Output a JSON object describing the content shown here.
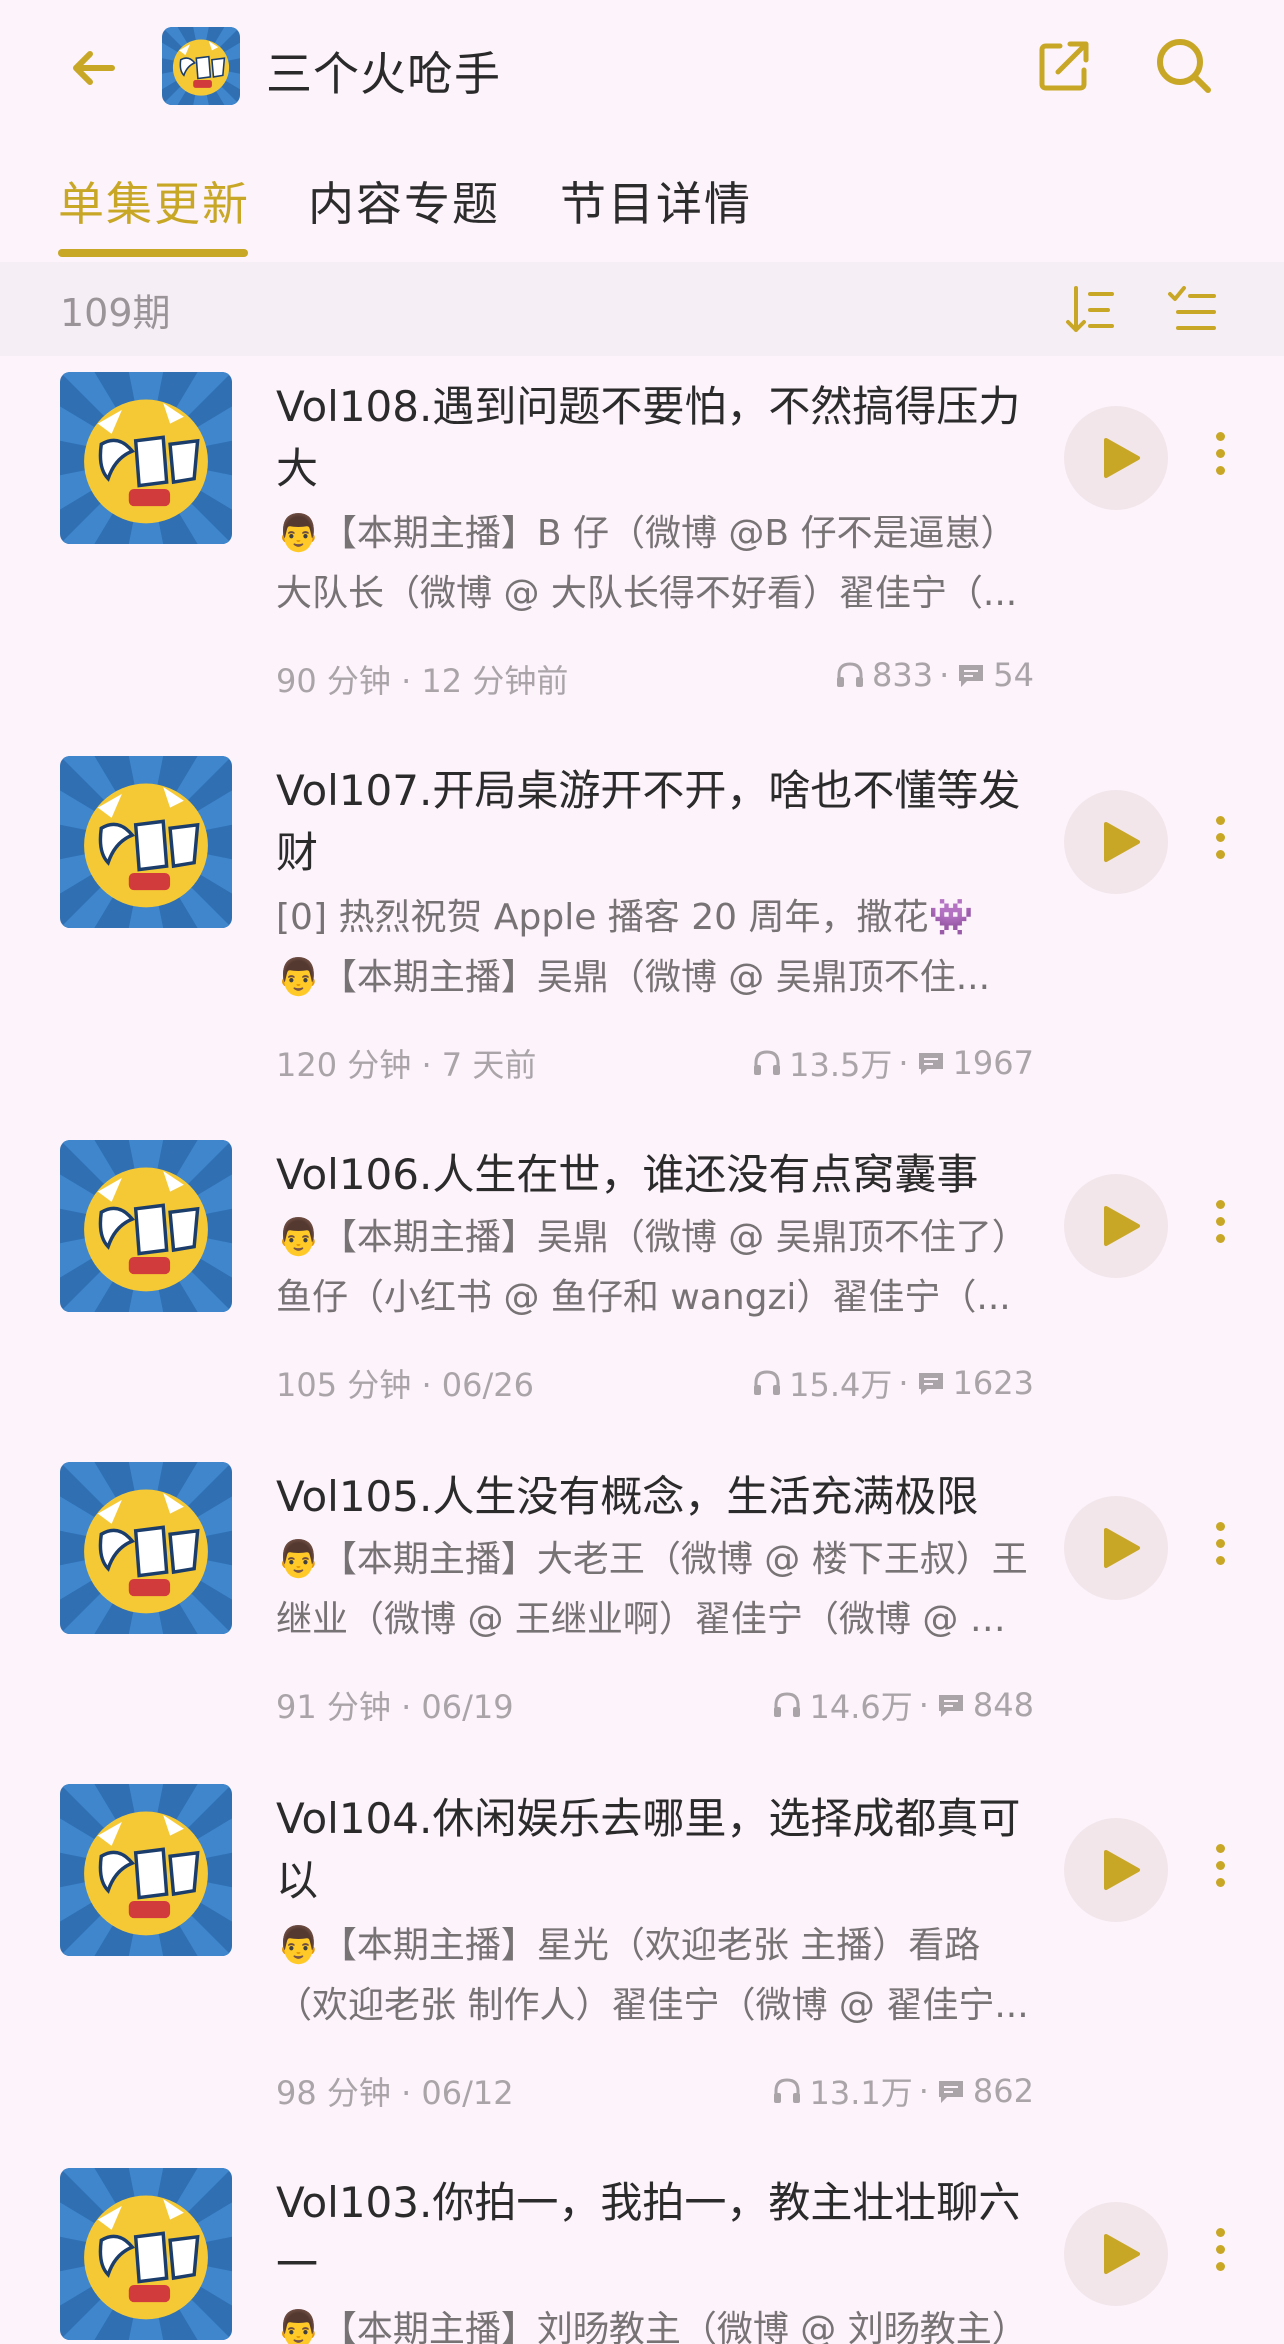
{
  "header": {
    "title": "三个火呛手"
  },
  "tabs": [
    {
      "label": "单集更新",
      "active": true
    },
    {
      "label": "内容专题",
      "active": false
    },
    {
      "label": "节目详情",
      "active": false
    }
  ],
  "subbar": {
    "count": "109期"
  },
  "colors": {
    "accent": "#c9a726",
    "background": "#fcf3fb",
    "muted": "#aaa4a8"
  },
  "icons": {
    "back": "arrow-left-icon",
    "share": "share-icon",
    "search": "search-icon",
    "sort": "sort-icon",
    "filter": "filter-icon",
    "play": "play-icon",
    "more": "more-vertical-icon",
    "listen": "headphones-icon",
    "comment": "comment-icon"
  },
  "episodes": [
    {
      "title": "Vol108.遇到问题不要怕，不然搞得压力大",
      "desc": [
        "👨【本期主播】B 仔（微博 @B 仔不是逼崽）",
        "大队长（微博 @ 大队长得不好看）翟佳宁（..."
      ],
      "duration": "90 分钟",
      "date": "12 分钟前",
      "plays": "833",
      "comments": "54"
    },
    {
      "title": "Vol107.开局桌游开不开，啥也不懂等发财",
      "desc": [
        "[0] 热烈祝贺 Apple 播客 20 周年，撒花👾",
        "👨【本期主播】吴鼎（微博 @ 吴鼎顶不住..."
      ],
      "duration": "120 分钟",
      "date": "7 天前",
      "plays": "13.5万",
      "comments": "1967"
    },
    {
      "title": "Vol106.人生在世，谁还没有点窝囊事",
      "desc": [
        "👨【本期主播】吴鼎（微博 @ 吴鼎顶不住了）",
        "鱼仔（小红书 @ 鱼仔和 wangzi）翟佳宁（..."
      ],
      "duration": "105 分钟",
      "date": "06/26",
      "plays": "15.4万",
      "comments": "1623"
    },
    {
      "title": "Vol105.人生没有概念，生活充满极限",
      "desc": [
        "👨【本期主播】大老王（微博 @ 楼下王叔）王",
        "继业（微博 @ 王继业啊）翟佳宁（微博 @ 翟..."
      ],
      "duration": "91 分钟",
      "date": "06/19",
      "plays": "14.6万",
      "comments": "848"
    },
    {
      "title": "Vol104.休闲娱乐去哪里，选择成都真可以",
      "desc": [
        "👨【本期主播】星光（欢迎老张 主播）看路",
        "（欢迎老张 制作人）翟佳宁（微博 @ 翟佳宁..."
      ],
      "duration": "98 分钟",
      "date": "06/12",
      "plays": "13.1万",
      "comments": "862"
    },
    {
      "title": "Vol103.你拍一，我拍一，教主壮壮聊六一",
      "desc": [
        "👨【本期主播】刘旸教主（微博 @ 刘旸教主）"
      ],
      "duration": "",
      "date": "",
      "plays": "",
      "comments": ""
    }
  ]
}
